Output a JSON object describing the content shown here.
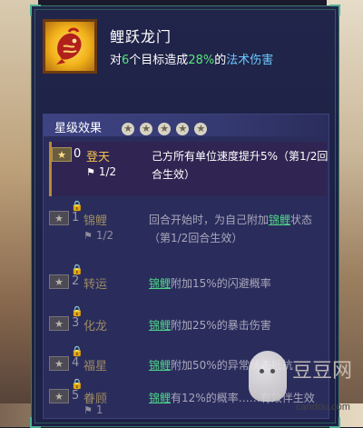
{
  "skill": {
    "name": "鲤跃龙门",
    "desc_prefix": "对",
    "desc_targets": "6",
    "desc_mid": "个目标造成",
    "desc_percent": "28%",
    "desc_of": "的",
    "desc_type": "法术伤害"
  },
  "star_section": {
    "title": "星级效果",
    "title_stars": [
      "★",
      "★",
      "★",
      "★",
      "★"
    ],
    "rows": [
      {
        "star": "★",
        "num": "0",
        "name": "登天",
        "flag": "⚑",
        "count": "1/2",
        "locked": false,
        "text_pre": "己方所有单位速度提升5%（第1/2回合生效）",
        "keyword": "",
        "text_post": ""
      },
      {
        "star": "★",
        "num": "1",
        "name": "锦鲤",
        "flag": "⚑",
        "count": "1/2",
        "locked": true,
        "text_pre": "回合开始时，为自己附加",
        "keyword": "锦鲤",
        "text_post": "状态（第1/2回合生效）"
      },
      {
        "star": "★",
        "num": "2",
        "name": "转运",
        "flag": "",
        "count": "",
        "locked": true,
        "text_pre": "",
        "keyword": "锦鲤",
        "text_post": "附加15%的闪避概率"
      },
      {
        "star": "★",
        "num": "3",
        "name": "化龙",
        "flag": "",
        "count": "",
        "locked": true,
        "text_pre": "",
        "keyword": "锦鲤",
        "text_post": "附加25%的暴击伤害"
      },
      {
        "star": "★",
        "num": "4",
        "name": "福星",
        "flag": "",
        "count": "",
        "locked": true,
        "text_pre": "",
        "keyword": "锦鲤",
        "text_post": "附加50%的异常状态抵抗"
      },
      {
        "star": "★",
        "num": "5",
        "name": "眷顾",
        "flag": "⚑",
        "count": "1",
        "locked": true,
        "text_pre": "",
        "keyword": "锦鲤",
        "text_post": "有12%的概率……有效伴生效"
      }
    ]
  },
  "watermark": {
    "text": "豆豆网",
    "url": "candou.com"
  },
  "colors": {
    "accent_gold": "#f4c04a",
    "accent_green": "#57e57a",
    "accent_blue": "#6cc9ff"
  }
}
